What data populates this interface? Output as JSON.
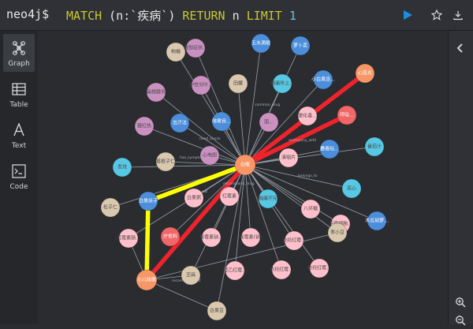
{
  "editor": {
    "prompt": "neo4j$",
    "query_kw1": "MATCH",
    "query_pattern": " (n:`疾病`) ",
    "query_kw2": "RETURN",
    "query_var": " n ",
    "query_kw3": "LIMIT",
    "query_limit": " 1"
  },
  "sidebar": {
    "items": [
      {
        "label": "Graph",
        "icon": "graph-icon",
        "active": true
      },
      {
        "label": "Table",
        "icon": "table-icon"
      },
      {
        "label": "Text",
        "icon": "text-icon"
      },
      {
        "label": "Code",
        "icon": "code-icon"
      }
    ]
  },
  "colors": {
    "orange": "#f79767",
    "purple": "#c990c0",
    "blue": "#4c8eda",
    "cyan": "#57c7e3",
    "pink": "#f16667",
    "lightpink": "#ffc0cb",
    "tan": "#d9c8ae",
    "red": "#f0232c",
    "yellow": "#ffff00"
  },
  "graph": {
    "nodes": [
      {
        "id": "center",
        "label": "白喉",
        "color": "orange"
      },
      {
        "id": "n1",
        "label": "枸橼",
        "color": "tan"
      },
      {
        "id": "n2",
        "label": "眼部症状...",
        "color": "purple"
      },
      {
        "id": "n3",
        "label": "五水滴眼",
        "color": "blue"
      },
      {
        "id": "n4",
        "label": "萝卜卖",
        "color": "blue"
      },
      {
        "id": "n5",
        "label": "心肌炎",
        "color": "orange"
      },
      {
        "id": "n6",
        "label": "中性分叶...",
        "color": "purple"
      },
      {
        "id": "n7",
        "label": "田螺",
        "color": "tan"
      },
      {
        "id": "n8",
        "label": "咽痛伴上...",
        "color": "cyan"
      },
      {
        "id": "n9",
        "label": "小白黄连...",
        "color": "blue"
      },
      {
        "id": "n10",
        "label": "扁桃腺炎",
        "color": "purple"
      },
      {
        "id": "n11",
        "label": "呼吸...",
        "color": "pink"
      },
      {
        "id": "n12",
        "label": "出汗法",
        "color": "blue"
      },
      {
        "id": "n13",
        "label": "咳嗽目...",
        "color": "blue"
      },
      {
        "id": "n14",
        "label": "猩红热",
        "color": "purple"
      },
      {
        "id": "n15",
        "label": "激化毒...",
        "color": "lightpink"
      },
      {
        "id": "n16",
        "label": "面...",
        "color": "purple"
      },
      {
        "id": "n17",
        "label": "心电图",
        "color": "purple"
      },
      {
        "id": "n18",
        "label": "番茄汁",
        "color": "cyan"
      },
      {
        "id": "n19",
        "label": "麝香贴...",
        "color": "blue"
      },
      {
        "id": "n20",
        "label": "清咽片",
        "color": "lightpink"
      },
      {
        "id": "n21",
        "label": "葛根子仁",
        "color": "tan"
      },
      {
        "id": "n22",
        "label": "发烧",
        "color": "cyan"
      },
      {
        "id": "n23",
        "label": "白果粥",
        "color": "lightpink"
      },
      {
        "id": "n24",
        "label": "恶心",
        "color": "cyan"
      },
      {
        "id": "n25",
        "label": "松子仁",
        "color": "tan"
      },
      {
        "id": "n26",
        "label": "白果扶子",
        "color": "blue"
      },
      {
        "id": "n27",
        "label": "红霉素",
        "color": "lightpink"
      },
      {
        "id": "n28",
        "label": "胸痛不完",
        "color": "cyan"
      },
      {
        "id": "n29",
        "label": "八环糖",
        "color": "lightpink"
      },
      {
        "id": "n30",
        "label": "巨噬细胞...",
        "color": "lightpink"
      },
      {
        "id": "n31",
        "label": "木瓜胡萝...",
        "color": "blue"
      },
      {
        "id": "n32",
        "label": "红霉素肠...",
        "color": "lightpink"
      },
      {
        "id": "n33",
        "label": "枣小豆",
        "color": "tan"
      },
      {
        "id": "n34",
        "label": "疗愈料",
        "color": "pink"
      },
      {
        "id": "n35",
        "label": "青霉素钠...",
        "color": "lightpink"
      },
      {
        "id": "n36",
        "label": "依托红霉...",
        "color": "lightpink"
      },
      {
        "id": "n37",
        "label": "青霉素(钠)",
        "color": "lightpink"
      },
      {
        "id": "n38",
        "label": "依托红霉...",
        "color": "lightpink"
      },
      {
        "id": "n39",
        "label": "琥乙红霉...",
        "color": "lightpink"
      },
      {
        "id": "n40",
        "label": "依托红霉...",
        "color": "lightpink"
      },
      {
        "id": "n41",
        "label": "小儿咳嗽",
        "color": "orange"
      },
      {
        "id": "n42",
        "label": "芝麻",
        "color": "tan"
      },
      {
        "id": "n43",
        "label": "白果豆",
        "color": "tan"
      }
    ],
    "relationships": [
      {
        "label": "do_eat"
      },
      {
        "label": "has_symptom"
      },
      {
        "label": "recommand_drug"
      },
      {
        "label": "need_check"
      },
      {
        "label": "no_eat"
      },
      {
        "label": "common_drug"
      },
      {
        "label": "acompany_with"
      },
      {
        "label": "belongs_to"
      },
      {
        "label": "recommand_eat"
      }
    ]
  }
}
